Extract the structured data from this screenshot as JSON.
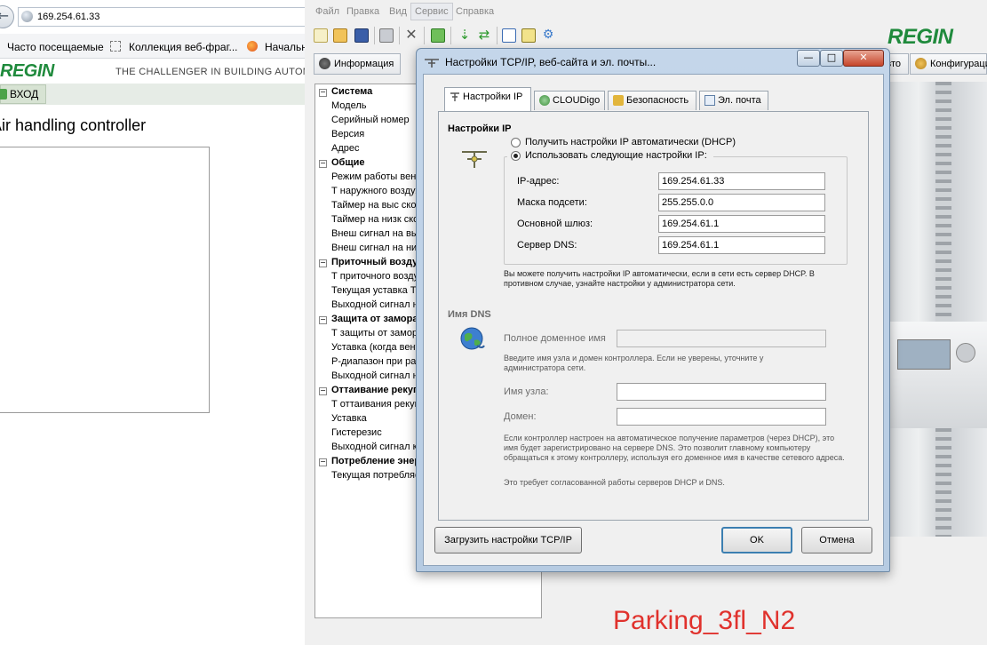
{
  "browser": {
    "url": "169.254.61.33",
    "bookmarks": [
      "Часто посещаемые",
      "Коллекция веб-фраг...",
      "Начальная"
    ],
    "logo": "REGIN",
    "tagline": "THE CHALLENGER IN BUILDING AUTOMATION",
    "login_label": "ВХОД",
    "heading": "Air handling controller"
  },
  "app": {
    "menus": [
      "Файл",
      "Правка",
      "Вид",
      "Сервис",
      "Справка"
    ],
    "active_menu": "Сервис",
    "logo": "REGIN",
    "tabs": [
      "Информация",
      "Авто",
      "Конфигурация"
    ],
    "tree": [
      {
        "type": "cat",
        "label": "Система"
      },
      {
        "type": "item",
        "label": "Модель"
      },
      {
        "type": "item",
        "label": "Серийный номер"
      },
      {
        "type": "item",
        "label": "Версия"
      },
      {
        "type": "item",
        "label": "Адрес"
      },
      {
        "type": "cat",
        "label": "Общие"
      },
      {
        "type": "item",
        "label": "Режим работы вентиляции"
      },
      {
        "type": "item",
        "label": "Т наружного воздуха"
      },
      {
        "type": "item",
        "label": "Таймер на выс скорость"
      },
      {
        "type": "item",
        "label": "Таймер на низк скорость"
      },
      {
        "type": "item",
        "label": "Внеш сигнал на выс скорость"
      },
      {
        "type": "item",
        "label": "Внеш сигнал на низк скорость"
      },
      {
        "type": "cat",
        "label": "Приточный воздух"
      },
      {
        "type": "item",
        "label": "Т приточного воздуха"
      },
      {
        "type": "item",
        "label": "Текущая уставка Т"
      },
      {
        "type": "item",
        "label": "Выходной сигнал нагрева"
      },
      {
        "type": "cat",
        "label": "Защита от замораживания"
      },
      {
        "type": "item",
        "label": "Т защиты от замораживания"
      },
      {
        "type": "item",
        "label": "Уставка (когда вентилятор выкл)"
      },
      {
        "type": "item",
        "label": "Р-диапазон при работе"
      },
      {
        "type": "item",
        "label": "Выходной сигнал нагрева"
      },
      {
        "type": "cat",
        "label": "Оттаивание рекуператора"
      },
      {
        "type": "item",
        "label": "Т оттаивания рекуператора"
      },
      {
        "type": "item",
        "label": "Уставка"
      },
      {
        "type": "item",
        "label": "Гистерезис"
      },
      {
        "type": "item",
        "label": "Выходной сигнал клапана"
      },
      {
        "type": "cat",
        "label": "Потребление энергии"
      },
      {
        "type": "item",
        "label": "Текущая потребляемая мощность"
      }
    ],
    "watermark": "Parking_3fl_N2"
  },
  "dialog": {
    "title": "Настройки TCP/IP, веб-сайта и эл. почты...",
    "tabs": [
      "Настройки IP",
      "CLOUDigo",
      "Безопасность",
      "Эл. почта"
    ],
    "ip_section": "Настройки IP",
    "radio_dhcp": "Получить настройки IP автоматически (DHCP)",
    "radio_static": "Использовать следующие настройки IP:",
    "fields": [
      {
        "label": "IP-адрес:",
        "value": "169.254.61.33"
      },
      {
        "label": "Маска подсети:",
        "value": "255.255.0.0"
      },
      {
        "label": "Основной шлюз:",
        "value": "169.254.61.1"
      },
      {
        "label": "Сервер DNS:",
        "value": "169.254.61.1"
      }
    ],
    "ip_note": "Вы можете получить настройки IP автоматически, если в сети есть сервер DHCP. В противном случае, узнайте настройки у администратора сети.",
    "dns_section": "Имя DNS",
    "fqdn_label": "Полное доменное имя",
    "fqdn_value": "",
    "dns_note": "Введите имя узла и домен контроллера. Если не уверены, уточните у администратора сети.",
    "host_label": "Имя узла:",
    "host_value": "",
    "domain_label": "Домен:",
    "domain_value": "",
    "dhcp_note": "Если контроллер настроен на автоматическое получение параметров (через DHCP), это имя будет зарегистрировано на сервере DNS. Это позволит главному компьютеру обращаться к этому контроллеру, используя его доменное имя в качестве сетевого адреса.",
    "dhcp_note2": "Это требует согласованной работы серверов DHCP и DNS.",
    "btn_load": "Загрузить настройки TCP/IP",
    "btn_ok": "OK",
    "btn_cancel": "Отмена"
  },
  "colors": {
    "regin_green": "#1f8a3c",
    "watermark_red": "#e0322d",
    "dialog_frame": "#b6cbe2"
  }
}
